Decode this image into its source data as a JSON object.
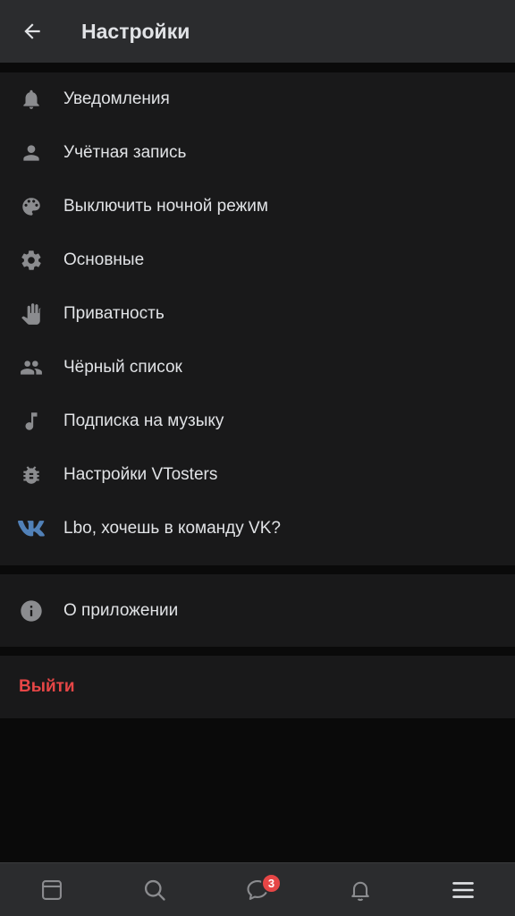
{
  "header": {
    "title": "Настройки",
    "back_icon": "arrow-left-icon"
  },
  "menu": {
    "items": [
      {
        "label": "Уведомления",
        "icon": "bell-icon"
      },
      {
        "label": "Учётная запись",
        "icon": "person-icon"
      },
      {
        "label": "Выключить ночной режим",
        "icon": "palette-icon"
      },
      {
        "label": "Основные",
        "icon": "gear-icon"
      },
      {
        "label": "Приватность",
        "icon": "hand-icon"
      },
      {
        "label": "Чёрный список",
        "icon": "people-icon"
      },
      {
        "label": "Подписка на музыку",
        "icon": "music-note-icon"
      },
      {
        "label": "Настройки VTosters",
        "icon": "bug-icon"
      },
      {
        "label": "Lbo, хочешь в команду VK?",
        "icon": "vk-logo-icon"
      }
    ],
    "about": {
      "label": "О приложении",
      "icon": "info-icon"
    },
    "logout": {
      "label": "Выйти"
    }
  },
  "tabbar": {
    "tabs": [
      {
        "name": "news",
        "icon": "newsfeed-icon"
      },
      {
        "name": "search",
        "icon": "search-icon"
      },
      {
        "name": "messages",
        "icon": "chat-bubble-icon",
        "badge": "3"
      },
      {
        "name": "notifications",
        "icon": "bell-icon"
      },
      {
        "name": "menu",
        "icon": "hamburger-menu-icon",
        "active": true
      }
    ]
  },
  "colors": {
    "header_bg": "#2b2c2e",
    "section_bg": "#19191a",
    "page_bg": "#0a0a0a",
    "icon_gray": "#8b8c8f",
    "text": "#e1e3e6",
    "logout_red": "#e64646",
    "vk_blue": "#5181b8",
    "badge_red": "#e64646"
  }
}
